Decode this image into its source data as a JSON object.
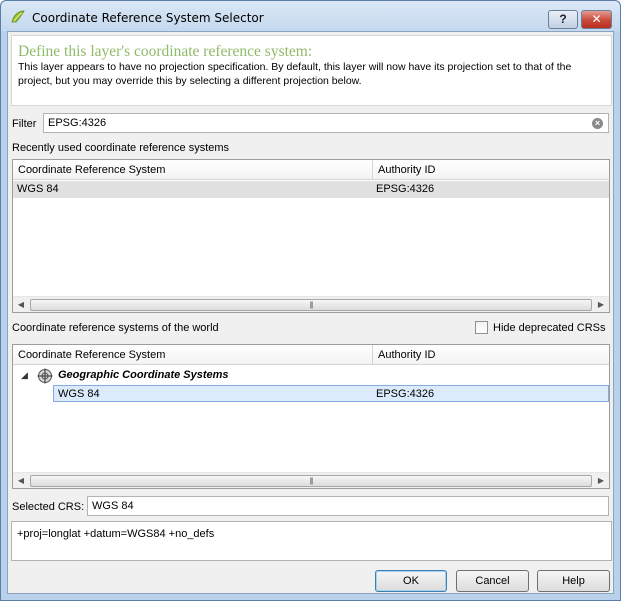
{
  "window": {
    "title": "Coordinate Reference System Selector",
    "help_label": "?",
    "close_label": "✕"
  },
  "header": {
    "title": "Define this layer's coordinate reference system:",
    "description": "This layer appears to have no projection specification. By default, this layer will now have its projection set to that of the project, but you may override this by selecting a different projection below."
  },
  "filter": {
    "label": "Filter",
    "value": "EPSG:4326"
  },
  "recent": {
    "label": "Recently used coordinate reference systems",
    "columns": [
      "Coordinate Reference System",
      "Authority ID"
    ],
    "rows": [
      {
        "name": "WGS 84",
        "authid": "EPSG:4326"
      }
    ]
  },
  "world": {
    "label": "Coordinate reference systems of the world",
    "hide_deprecated_label": "Hide deprecated CRSs",
    "hide_deprecated_checked": false,
    "columns": [
      "Coordinate Reference System",
      "Authority ID"
    ],
    "group": "Geographic Coordinate Systems",
    "rows": [
      {
        "name": "WGS 84",
        "authid": "EPSG:4326"
      }
    ]
  },
  "selected": {
    "label": "Selected CRS:",
    "value": "WGS 84"
  },
  "proj_string": "+proj=longlat +datum=WGS84 +no_defs",
  "buttons": {
    "ok": "OK",
    "cancel": "Cancel",
    "help": "Help"
  },
  "colors": {
    "header_title": "#8fba6a",
    "selection": "#dcebfc",
    "close_button": "#c8483a"
  }
}
